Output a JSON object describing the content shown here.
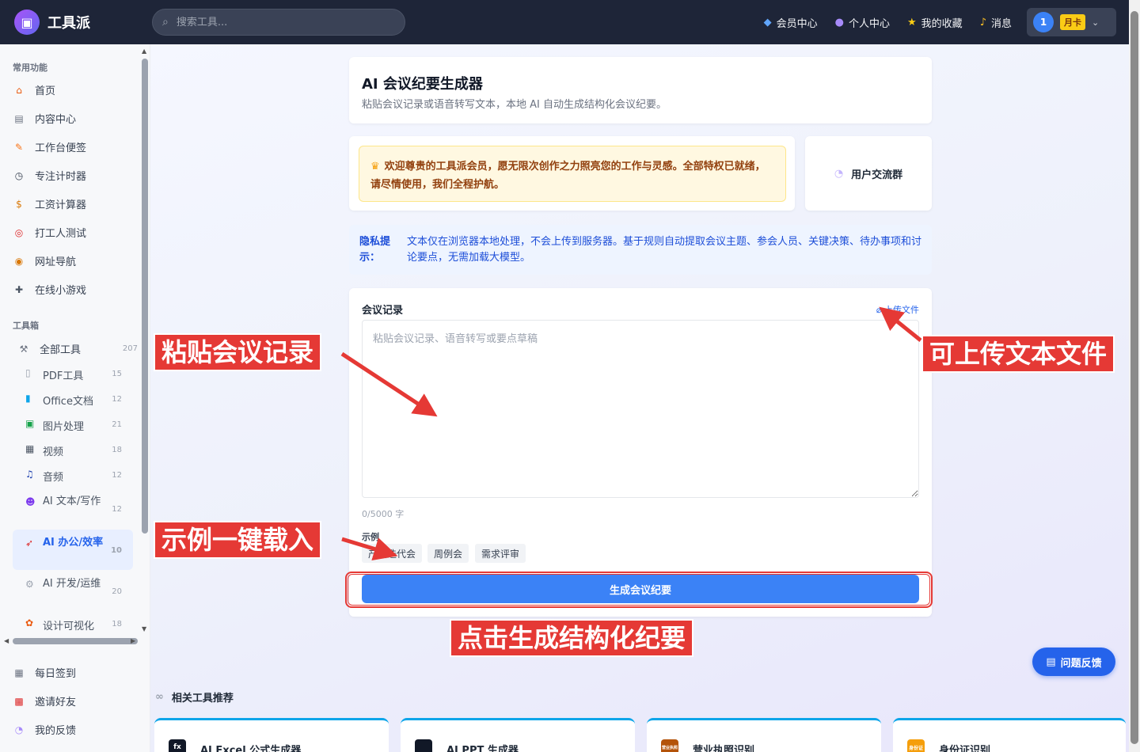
{
  "app": {
    "name": "工具派"
  },
  "search": {
    "placeholder": "搜索工具..."
  },
  "topnav": [
    {
      "label": "会员中心",
      "icon": "diamond-icon"
    },
    {
      "label": "个人中心",
      "icon": "person-icon"
    },
    {
      "label": "我的收藏",
      "icon": "star-icon"
    },
    {
      "label": "消息",
      "icon": "bell-icon"
    }
  ],
  "user": {
    "avatar_text": "1",
    "badge": "月卡"
  },
  "sidebar": {
    "common_title": "常用功能",
    "common": [
      {
        "label": "首页",
        "icon": "home-icon"
      },
      {
        "label": "内容中心",
        "icon": "newspaper-icon"
      },
      {
        "label": "工作台便签",
        "icon": "memo-icon"
      },
      {
        "label": "专注计时器",
        "icon": "timer-icon"
      },
      {
        "label": "工资计算器",
        "icon": "money-bag-icon"
      },
      {
        "label": "打工人测试",
        "icon": "target-icon"
      },
      {
        "label": "网址导航",
        "icon": "compass-icon"
      },
      {
        "label": "在线小游戏",
        "icon": "gamepad-icon"
      }
    ],
    "toolbox_title": "工具箱",
    "all_tools": {
      "label": "全部工具",
      "count": "207"
    },
    "categories": [
      {
        "label": "PDF工具",
        "count": "15",
        "icon": "pdf-icon"
      },
      {
        "label": "Office文档",
        "count": "12",
        "icon": "office-icon"
      },
      {
        "label": "图片处理",
        "count": "21",
        "icon": "image-icon"
      },
      {
        "label": "视频",
        "count": "18",
        "icon": "clapper-icon"
      },
      {
        "label": "音频",
        "count": "12",
        "icon": "music-icon"
      },
      {
        "label": "AI 文本/写作",
        "count": "12",
        "icon": "robot-icon"
      },
      {
        "label": "AI 办公/效率",
        "count": "10",
        "icon": "rocket-icon"
      },
      {
        "label": "AI 开发/运维",
        "count": "20",
        "icon": "wrench-icon"
      },
      {
        "label": "设计可视化",
        "count": "18",
        "icon": "palette-icon"
      }
    ],
    "bottom": [
      {
        "label": "每日签到",
        "icon": "calendar-icon"
      },
      {
        "label": "邀请好友",
        "icon": "gift-icon"
      },
      {
        "label": "我的反馈",
        "icon": "speech-icon"
      }
    ]
  },
  "page": {
    "title": "AI 会议纪要生成器",
    "subtitle": "粘贴会议记录或语音转写文本，本地 AI 自动生成结构化会议纪要。",
    "welcome": "欢迎尊贵的工具派会员，愿无限次创作之力照亮您的工作与灵感。全部特权已就绪，请尽情使用，我们全程护航。",
    "group_label": "用户交流群",
    "privacy_label": "隐私提示：",
    "privacy_text": "文本仅在浏览器本地处理，不会上传到服务器。基于规则自动提取会议主题、参会人员、关键决策、待办事项和讨论要点，无需加载大模型。",
    "field_label": "会议记录",
    "upload_label": "上传文件",
    "textarea_placeholder": "粘贴会议记录、语音转写或要点草稿",
    "counter": "0/5000 字",
    "examples_label": "示例",
    "examples": [
      "产品迭代会",
      "周例会",
      "需求评审"
    ],
    "generate_label": "生成会议纪要"
  },
  "annotations": {
    "paste": "粘贴会议记录",
    "upload": "可上传文本文件",
    "example": "示例一键载入",
    "generate": "点击生成结构化纪要"
  },
  "feedback": {
    "label": "问题反馈"
  },
  "related": {
    "title": "相关工具推荐",
    "items": [
      {
        "label": "AI Excel 公式生成器",
        "icon": "fx-icon",
        "icon_text": "fx"
      },
      {
        "label": "AI PPT 生成器",
        "icon": "presentation-icon",
        "icon_text": ""
      },
      {
        "label": "营业执照识别",
        "icon": "license-icon",
        "icon_text": "营业执照"
      },
      {
        "label": "身份证识别",
        "icon": "id-card-icon",
        "icon_text": "身份证"
      }
    ]
  },
  "colors": {
    "accent": "#3b82f6",
    "topbar": "#1e2538",
    "annotation_red": "#e53935"
  }
}
